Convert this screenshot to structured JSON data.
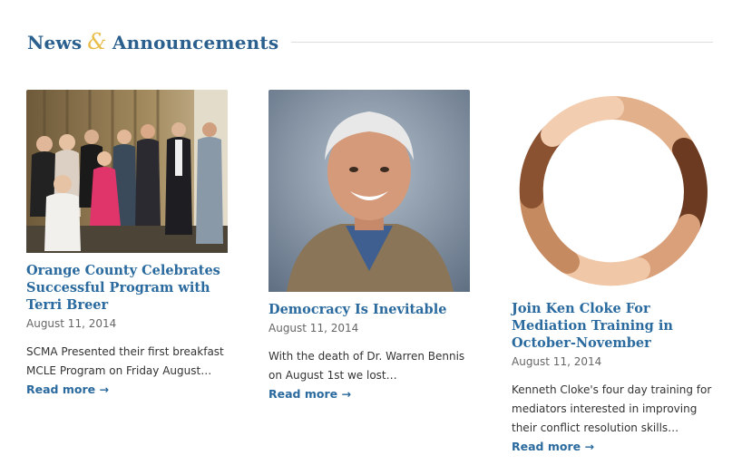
{
  "section": {
    "title_part1": "News",
    "ampersand": "&",
    "title_part2": "Announcements"
  },
  "articles": [
    {
      "title": "Orange County Celebrates Successful Program with Terri Breer",
      "date": "August 11, 2014",
      "excerpt": "SCMA Presented their first breakfast MCLE Program on Friday August…",
      "read_more": "Read more →"
    },
    {
      "title": "Democracy Is Inevitable",
      "date": "August 11, 2014",
      "excerpt": "With the death of Dr. Warren Bennis on August 1st we lost…",
      "read_more": "Read more →"
    },
    {
      "title": "Join Ken Cloke For Mediation Training in October-November",
      "date": "August 11, 2014",
      "excerpt": "Kenneth Cloke's four day training for mediators interested in improving their conflict resolution skills…",
      "read_more": "Read more →"
    }
  ]
}
